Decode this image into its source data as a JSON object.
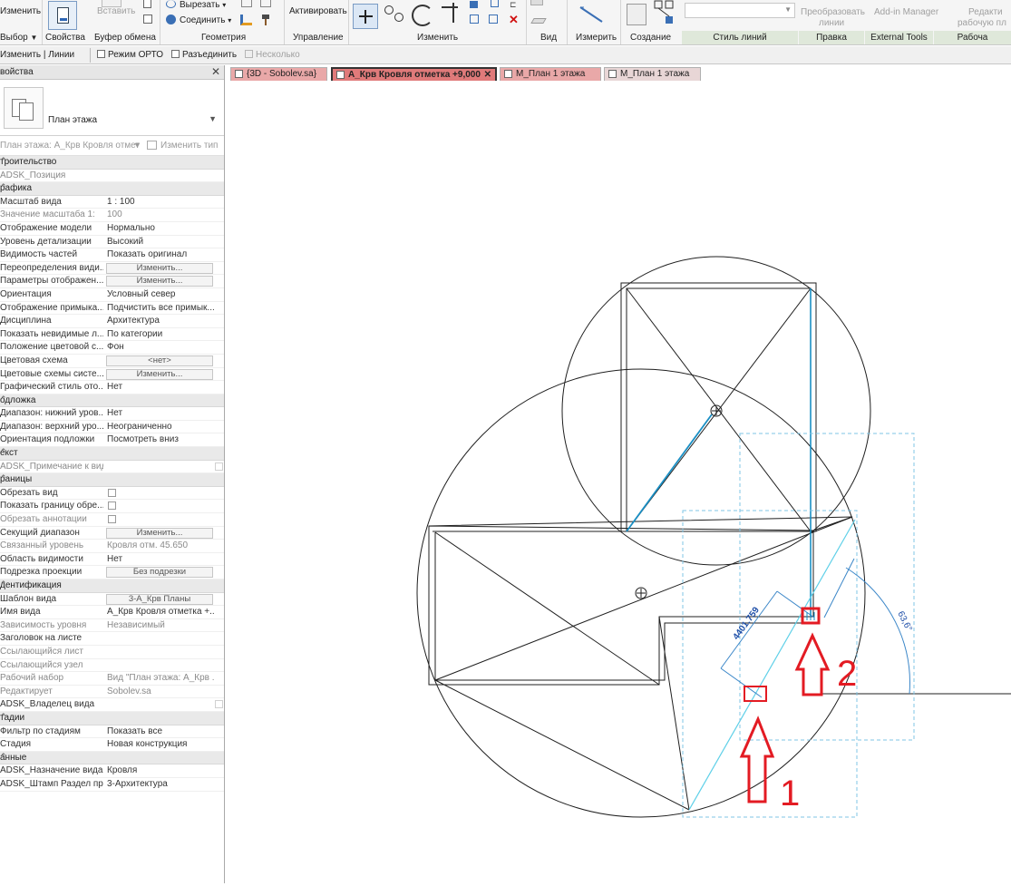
{
  "ribbon": {
    "modify_label": "Изменить",
    "select_label": "Выбор",
    "properties_label": "Свойства",
    "paste_label": "Вставить",
    "clipboard_label": "Буфер обмена",
    "cut_label": "Вырезать",
    "join_label": "Соединить",
    "geometry_label": "Геометрия",
    "activate_label": "Активировать",
    "control_label": "Управление",
    "modify_group_label": "Изменить",
    "view_label": "Вид",
    "measure_label": "Измерить",
    "create_label": "Создание",
    "line_style_label": "Стиль линий",
    "edit_label": "Правка",
    "convert_lines_label1": "Преобразовать",
    "convert_lines_label2": "линии",
    "addin_manager_label": "Add-in Manager",
    "external_tools_label": "External Tools",
    "edit_workplane_label1": "Редакти",
    "edit_workplane_label2": "рабочую пл",
    "workplane_group_label": "Рабоча"
  },
  "options": {
    "context_label": "Изменить | Линии",
    "ortho_label": "Режим ОРТО",
    "disjoin_label": "Разъединить",
    "multiple_label": "Несколько"
  },
  "properties": {
    "title": "войства",
    "type_name": "План этажа",
    "instance_selector": "План этажа: А_Крв Кровля отмет",
    "edit_type": "Изменить тип",
    "sections": [
      {
        "title": "троительство",
        "rows": [
          {
            "k": "ADSK_Позиция",
            "v": "",
            "kind": "text",
            "dim": true
          }
        ]
      },
      {
        "title": "рафика",
        "rows": [
          {
            "k": "Масштаб вида",
            "v": "1 : 100",
            "kind": "text"
          },
          {
            "k": "Значение масштаба    1:",
            "v": "100",
            "kind": "text",
            "dim": true
          },
          {
            "k": "Отображение модели",
            "v": "Нормально",
            "kind": "text"
          },
          {
            "k": "Уровень детализации",
            "v": "Высокий",
            "kind": "text"
          },
          {
            "k": "Видимость частей",
            "v": "Показать оригинал",
            "kind": "text"
          },
          {
            "k": "Переопределения види...",
            "v": "Изменить...",
            "kind": "button"
          },
          {
            "k": "Параметры отображен...",
            "v": "Изменить...",
            "kind": "button"
          },
          {
            "k": "Ориентация",
            "v": "Условный север",
            "kind": "text"
          },
          {
            "k": "Отображение примыка...",
            "v": "Подчистить все примык...",
            "kind": "text"
          },
          {
            "k": "Дисциплина",
            "v": "Архитектура",
            "kind": "text"
          },
          {
            "k": "Показать невидимые л...",
            "v": "По категории",
            "kind": "text"
          },
          {
            "k": "Положение цветовой с...",
            "v": "Фон",
            "kind": "text"
          },
          {
            "k": "Цветовая схема",
            "v": "<нет>",
            "kind": "button"
          },
          {
            "k": "Цветовые схемы систе...",
            "v": "Изменить...",
            "kind": "button"
          },
          {
            "k": "Графический стиль ото...",
            "v": "Нет",
            "kind": "text"
          }
        ]
      },
      {
        "title": "одложка",
        "rows": [
          {
            "k": "Диапазон: нижний уров...",
            "v": "Нет",
            "kind": "text"
          },
          {
            "k": "Диапазон: верхний уро...",
            "v": "Неограниченно",
            "kind": "text"
          },
          {
            "k": "Ориентация подложки",
            "v": "Посмотреть вниз",
            "kind": "text"
          }
        ]
      },
      {
        "title": "екст",
        "rows": [
          {
            "k": "ADSK_Примечание к виду",
            "v": "",
            "kind": "checkright",
            "dim": true
          }
        ]
      },
      {
        "title": "раницы",
        "rows": [
          {
            "k": "Обрезать вид",
            "v": "",
            "kind": "check"
          },
          {
            "k": "Показать границу обре...",
            "v": "",
            "kind": "check"
          },
          {
            "k": "Обрезать аннотации",
            "v": "",
            "kind": "check",
            "dim": true
          },
          {
            "k": "Секущий диапазон",
            "v": "Изменить...",
            "kind": "button"
          },
          {
            "k": "Связанный уровень",
            "v": "Кровля отм. 45.650",
            "kind": "text",
            "dim": true
          },
          {
            "k": "Область видимости",
            "v": "Нет",
            "kind": "text"
          },
          {
            "k": "Подрезка проекции",
            "v": "Без подрезки",
            "kind": "button"
          }
        ]
      },
      {
        "title": "дентификация",
        "rows": [
          {
            "k": "Шаблон вида",
            "v": "3-А_Крв Планы",
            "kind": "button"
          },
          {
            "k": "Имя вида",
            "v": "А_Крв Кровля отметка +...",
            "kind": "text"
          },
          {
            "k": "Зависимость уровня",
            "v": "Независимый",
            "kind": "text",
            "dim": true
          },
          {
            "k": "Заголовок на листе",
            "v": "",
            "kind": "text"
          },
          {
            "k": "Ссылающийся лист",
            "v": "",
            "kind": "text",
            "dim": true
          },
          {
            "k": "Ссылающийся узел",
            "v": "",
            "kind": "text",
            "dim": true
          },
          {
            "k": "Рабочий набор",
            "v": "Вид \"План этажа: А_Крв ...",
            "kind": "text",
            "dim": true
          },
          {
            "k": "Редактирует",
            "v": "Sobolev.sa",
            "kind": "text",
            "dim": true
          },
          {
            "k": "ADSK_Владелец вида",
            "v": "",
            "kind": "checkright"
          }
        ]
      },
      {
        "title": "тадии",
        "rows": [
          {
            "k": "Фильтр по стадиям",
            "v": "Показать все",
            "kind": "text"
          },
          {
            "k": "Стадия",
            "v": "Новая конструкция",
            "kind": "text"
          }
        ]
      },
      {
        "title": "анные",
        "rows": [
          {
            "k": "ADSK_Назначение вида",
            "v": "Кровля",
            "kind": "text"
          },
          {
            "k": "ADSK_Штамп Раздел пр...",
            "v": "3-Архитектура",
            "kind": "text"
          }
        ]
      }
    ]
  },
  "tabs": [
    {
      "label": "{3D - Sobolev.sa}",
      "active": false,
      "color": "#e9a8a8"
    },
    {
      "label": "А_Крв Кровля отметка +9,000",
      "active": true,
      "color": "#e07a7a"
    },
    {
      "label": "М_План 1 этажа",
      "active": false,
      "color": "#e9a8a8"
    },
    {
      "label": "М_План 1 этажа",
      "active": false,
      "color": "#e8d6d6"
    }
  ],
  "canvas": {
    "dimension_label": "4401.759",
    "angle_label": "63,6°",
    "marker1_label": "1",
    "marker2_label": "2",
    "annotation_color": "#e31b23",
    "line_color": "#1f1f1f",
    "selection_color": "#1a8fc4"
  }
}
